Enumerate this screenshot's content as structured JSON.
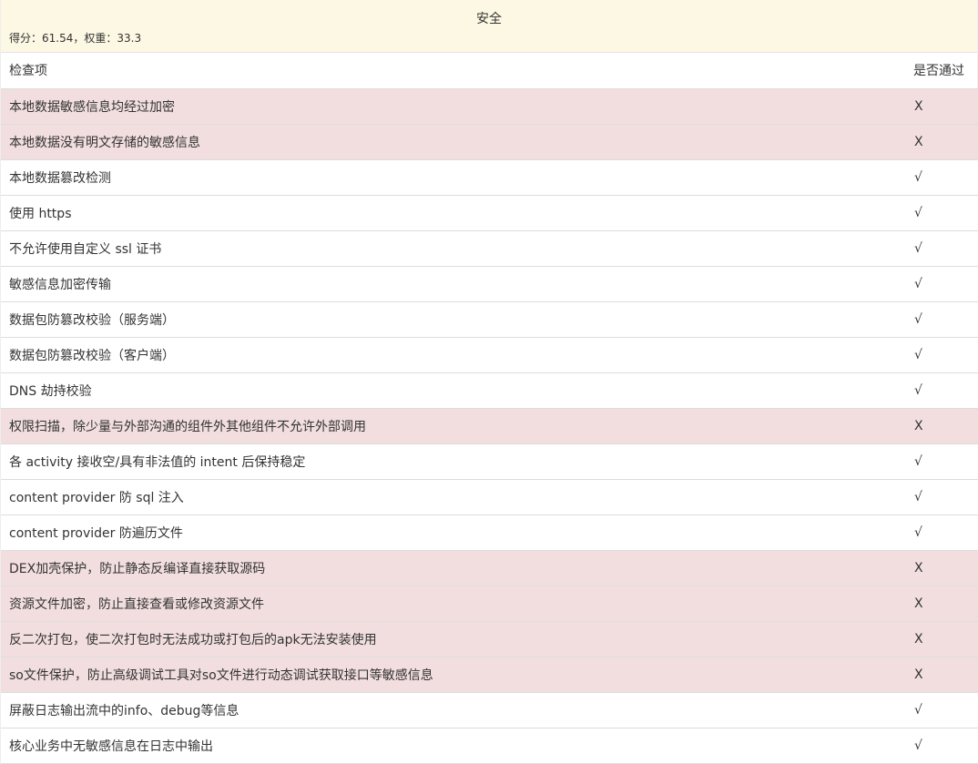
{
  "section": {
    "title": "安全",
    "score_line": "得分：61.54，权重：33.3"
  },
  "table": {
    "headers": {
      "item": "检查项",
      "pass": "是否通过"
    },
    "rows": [
      {
        "item": "本地数据敏感信息均经过加密",
        "mark": "X",
        "status": "fail"
      },
      {
        "item": "本地数据没有明文存储的敏感信息",
        "mark": "X",
        "status": "fail"
      },
      {
        "item": "本地数据篡改检测",
        "mark": "√",
        "status": "pass"
      },
      {
        "item": "使用 https",
        "mark": "√",
        "status": "pass"
      },
      {
        "item": "不允许使用自定义 ssl 证书",
        "mark": "√",
        "status": "pass"
      },
      {
        "item": "敏感信息加密传输",
        "mark": "√",
        "status": "pass"
      },
      {
        "item": "数据包防篡改校验（服务端）",
        "mark": "√",
        "status": "pass"
      },
      {
        "item": "数据包防篡改校验（客户端）",
        "mark": "√",
        "status": "pass"
      },
      {
        "item": "DNS 劫持校验",
        "mark": "√",
        "status": "pass"
      },
      {
        "item": "权限扫描，除少量与外部沟通的组件外其他组件不允许外部调用",
        "mark": "X",
        "status": "fail"
      },
      {
        "item": "各 activity 接收空/具有非法值的 intent 后保持稳定",
        "mark": "√",
        "status": "pass"
      },
      {
        "item": "content provider 防 sql 注入",
        "mark": "√",
        "status": "pass"
      },
      {
        "item": "content provider 防遍历文件",
        "mark": "√",
        "status": "pass"
      },
      {
        "item": "DEX加壳保护，防止静态反编译直接获取源码",
        "mark": "X",
        "status": "fail"
      },
      {
        "item": "资源文件加密，防止直接查看或修改资源文件",
        "mark": "X",
        "status": "fail"
      },
      {
        "item": "反二次打包，使二次打包时无法成功或打包后的apk无法安装使用",
        "mark": "X",
        "status": "fail"
      },
      {
        "item": "so文件保护，防止高级调试工具对so文件进行动态调试获取接口等敏感信息",
        "mark": "X",
        "status": "fail"
      },
      {
        "item": "屏蔽日志输出流中的info、debug等信息",
        "mark": "√",
        "status": "pass"
      },
      {
        "item": "核心业务中无敏感信息在日志中输出",
        "mark": "√",
        "status": "pass"
      }
    ]
  },
  "colors": {
    "header_bg": "#fcf8e3",
    "fail_row_bg": "#f2dede",
    "pass_row_bg": "#ffffff"
  }
}
